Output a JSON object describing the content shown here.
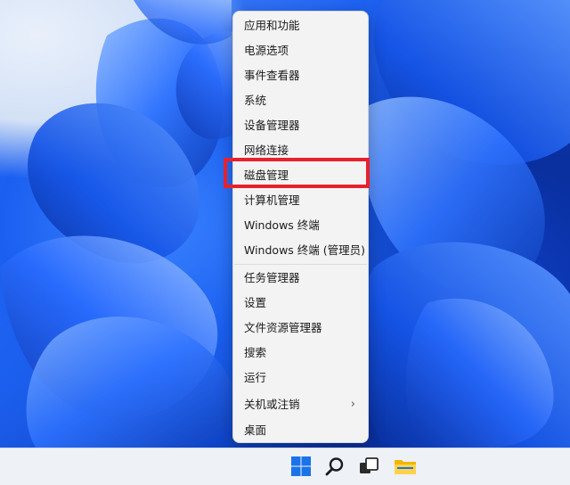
{
  "context_menu": {
    "groups": [
      [
        "应用和功能",
        "电源选项",
        "事件查看器",
        "系统",
        "设备管理器",
        "网络连接",
        "磁盘管理",
        "计算机管理",
        "Windows 终端",
        "Windows 终端 (管理员)"
      ],
      [
        "任务管理器",
        "设置",
        "文件资源管理器",
        "搜索",
        "运行",
        "关机或注销",
        "桌面"
      ]
    ],
    "highlighted_item": "磁盘管理",
    "submenu_item": "关机或注销"
  },
  "colors": {
    "highlight_border": "#e8212b",
    "menu_background": "#f3f3f3",
    "taskbar_background": "#eef1f6",
    "windows_blue": "#1a73e8"
  },
  "taskbar": {
    "icons": [
      "windows-start-icon",
      "search-icon",
      "task-view-icon",
      "file-explorer-icon"
    ]
  }
}
